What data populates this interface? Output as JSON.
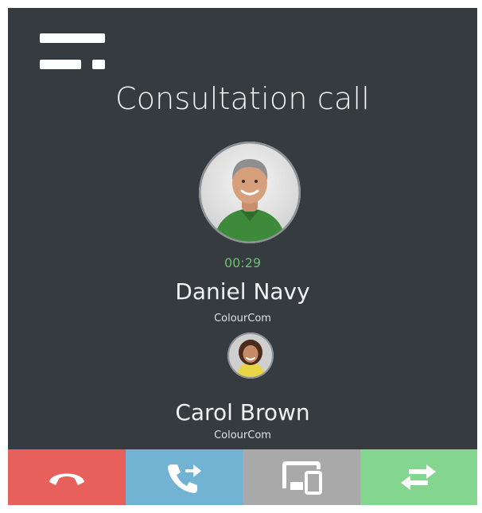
{
  "window": {
    "menu_icon": "menu-icon"
  },
  "call": {
    "title": "Consultation call",
    "timer": "00:29",
    "primary": {
      "name": "Daniel Navy",
      "company": "ColourCom"
    },
    "secondary": {
      "name": "Carol Brown",
      "company": "ColourCom"
    }
  },
  "actions": [
    {
      "icon": "hangup-icon",
      "color": "#e8605c"
    },
    {
      "icon": "transfer-call-icon",
      "color": "#72b3d4"
    },
    {
      "icon": "device-switch-icon",
      "color": "#a9a9a9"
    },
    {
      "icon": "swap-calls-icon",
      "color": "#84d58f"
    }
  ],
  "colors": {
    "background": "#363b3f",
    "timer": "#6fbf73"
  }
}
